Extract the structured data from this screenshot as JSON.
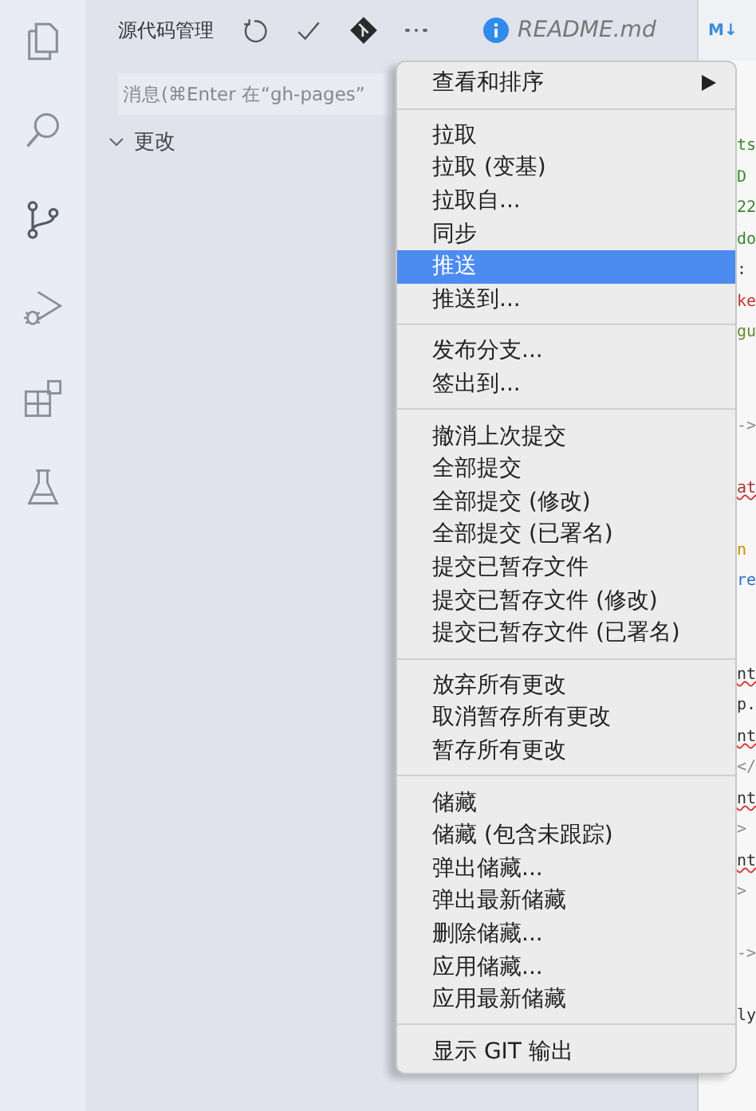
{
  "sidebar": {
    "title": "源代码管理",
    "message_field": {
      "placeholder": "消息(⌘Enter 在“gh-pages”"
    },
    "section": {
      "label": "更改",
      "expanded": true
    }
  },
  "editor_tab": {
    "title": "README.md"
  },
  "editor_toolbar": {
    "preview_label": "M↓"
  },
  "editor_lines": [
    {
      "kind": "code",
      "text": "ts",
      "color": "#3a8a2e",
      "error": false
    },
    {
      "kind": "code",
      "text": "D",
      "color": "#3a8a2e",
      "error": false
    },
    {
      "kind": "code",
      "text": "22",
      "color": "#3a8a2e",
      "error": false
    },
    {
      "kind": "code",
      "text": "do",
      "color": "#3a8a2e",
      "error": false
    },
    {
      "kind": "code",
      "text": ":",
      "color": "#333333",
      "error": false
    },
    {
      "kind": "code",
      "text": "ke",
      "color": "#c0392b",
      "error": false
    },
    {
      "kind": "code",
      "text": "gu",
      "color": "#6a8a2e",
      "error": false
    },
    {
      "kind": "blank"
    },
    {
      "kind": "blank"
    },
    {
      "kind": "code",
      "text": "->",
      "color": "#8a8a8a",
      "error": false
    },
    {
      "kind": "blank"
    },
    {
      "kind": "code",
      "text": "at",
      "color": "#b03030",
      "error": true
    },
    {
      "kind": "blank"
    },
    {
      "kind": "code",
      "text": "n",
      "color": "#c98a00",
      "error": false
    },
    {
      "kind": "code",
      "text": "re",
      "color": "#2f6fd0",
      "error": false
    },
    {
      "kind": "blank"
    },
    {
      "kind": "blank"
    },
    {
      "kind": "code",
      "text": "nt",
      "color": "#333333",
      "error": true
    },
    {
      "kind": "code",
      "text": "p.",
      "color": "#333333",
      "error": false
    },
    {
      "kind": "code",
      "text": "nt",
      "color": "#333333",
      "error": true
    },
    {
      "kind": "code",
      "text": "</",
      "color": "#8a8a8a",
      "error": false
    },
    {
      "kind": "code",
      "text": "nt",
      "color": "#333333",
      "error": true
    },
    {
      "kind": "code",
      "text": ">",
      "color": "#8a8a8a",
      "error": false
    },
    {
      "kind": "code",
      "text": "nt",
      "color": "#333333",
      "error": true
    },
    {
      "kind": "code",
      "text": ">",
      "color": "#8a8a8a",
      "error": false
    },
    {
      "kind": "blank"
    },
    {
      "kind": "code",
      "text": "->",
      "color": "#8a8a8a",
      "error": false
    },
    {
      "kind": "blank"
    },
    {
      "kind": "code",
      "text": "ly",
      "color": "#333333",
      "error": false
    }
  ],
  "menu": {
    "groups": [
      [
        {
          "label": "查看和排序",
          "selected": false,
          "submenu": true
        }
      ],
      [
        {
          "label": "拉取",
          "selected": false,
          "submenu": false
        },
        {
          "label": "拉取 (变基)",
          "selected": false,
          "submenu": false
        },
        {
          "label": "拉取自...",
          "selected": false,
          "submenu": false
        },
        {
          "label": "同步",
          "selected": false,
          "submenu": false
        },
        {
          "label": "推送",
          "selected": true,
          "submenu": false
        },
        {
          "label": "推送到...",
          "selected": false,
          "submenu": false
        }
      ],
      [
        {
          "label": "发布分支...",
          "selected": false,
          "submenu": false
        },
        {
          "label": "签出到...",
          "selected": false,
          "submenu": false
        }
      ],
      [
        {
          "label": "撤消上次提交",
          "selected": false,
          "submenu": false
        },
        {
          "label": "全部提交",
          "selected": false,
          "submenu": false
        },
        {
          "label": "全部提交 (修改)",
          "selected": false,
          "submenu": false
        },
        {
          "label": "全部提交 (已署名)",
          "selected": false,
          "submenu": false
        },
        {
          "label": "提交已暂存文件",
          "selected": false,
          "submenu": false
        },
        {
          "label": "提交已暂存文件 (修改)",
          "selected": false,
          "submenu": false
        },
        {
          "label": "提交已暂存文件 (已署名)",
          "selected": false,
          "submenu": false
        }
      ],
      [
        {
          "label": "放弃所有更改",
          "selected": false,
          "submenu": false
        },
        {
          "label": "取消暂存所有更改",
          "selected": false,
          "submenu": false
        },
        {
          "label": "暂存所有更改",
          "selected": false,
          "submenu": false
        }
      ],
      [
        {
          "label": "储藏",
          "selected": false,
          "submenu": false
        },
        {
          "label": "储藏 (包含未跟踪)",
          "selected": false,
          "submenu": false
        },
        {
          "label": "弹出储藏...",
          "selected": false,
          "submenu": false
        },
        {
          "label": "弹出最新储藏",
          "selected": false,
          "submenu": false
        },
        {
          "label": "删除储藏...",
          "selected": false,
          "submenu": false
        },
        {
          "label": "应用储藏...",
          "selected": false,
          "submenu": false
        },
        {
          "label": "应用最新储藏",
          "selected": false,
          "submenu": false
        }
      ],
      [
        {
          "label": "显示 GIT 输出",
          "selected": false,
          "submenu": false
        }
      ]
    ]
  }
}
